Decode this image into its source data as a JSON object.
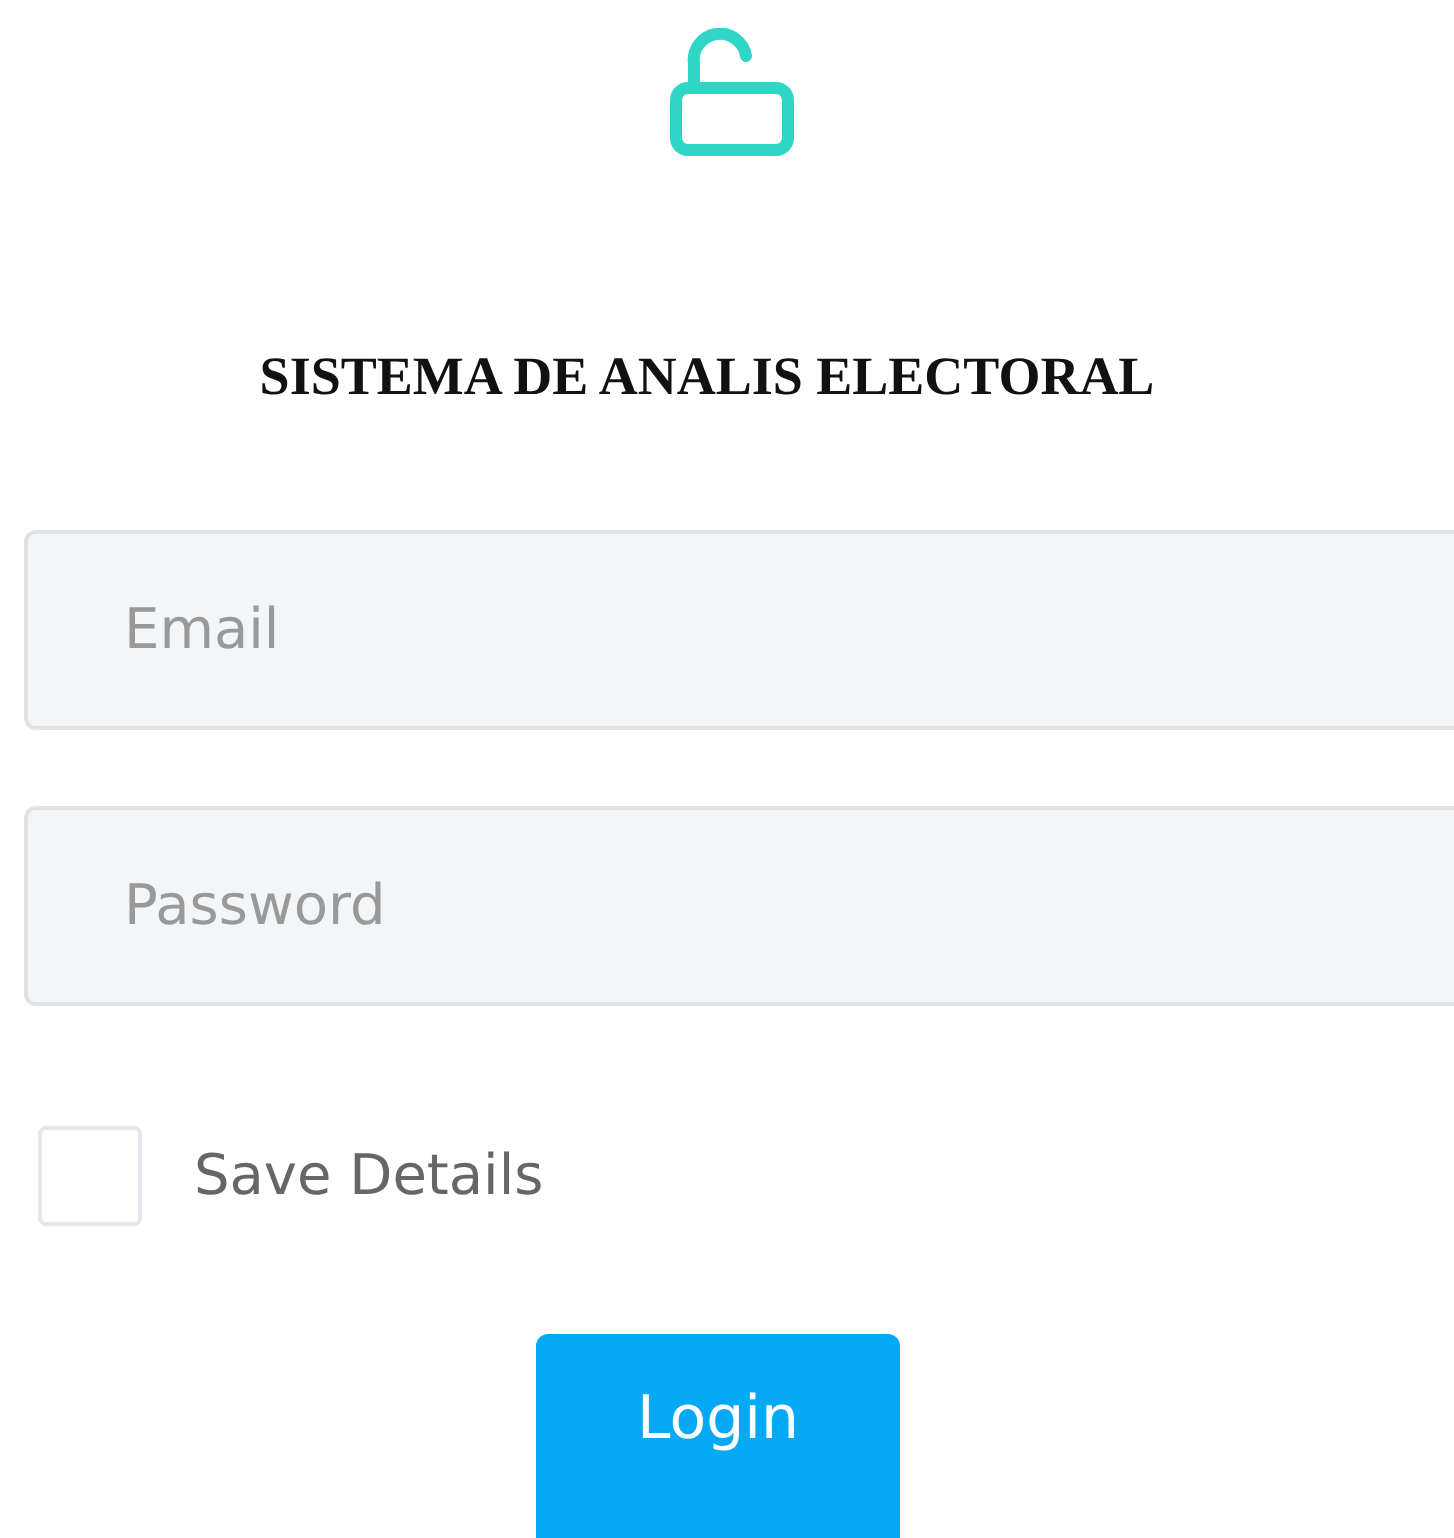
{
  "title": "SISTEMA DE ANALIS ELECTORAL",
  "fields": [
    {
      "placeholder": "Email"
    },
    {
      "placeholder": "Password"
    }
  ],
  "save_details": {
    "label": "Save Details",
    "checked": false
  },
  "login_button": {
    "label": "Login"
  }
}
